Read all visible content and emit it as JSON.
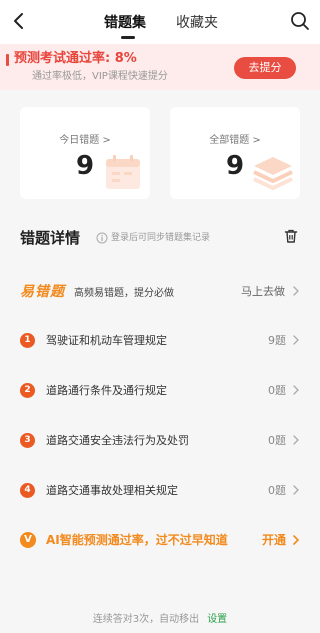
{
  "nav": {
    "tabs": [
      {
        "label": "错题集",
        "active": true
      },
      {
        "label": "收藏夹",
        "active": false
      }
    ]
  },
  "promo": {
    "title": "预测考试通过率: 8%",
    "subtitle": "通过率极低，VIP课程快速提分",
    "button": "去提分",
    "accent": "#e94c40",
    "background": "#fdeceb"
  },
  "stats": {
    "today": {
      "label": "今日错题 >",
      "value": "9"
    },
    "all": {
      "label": "全部错题 >",
      "value": "9"
    }
  },
  "detail": {
    "title": "错题详情",
    "hint": "登录后可同步错题集记录",
    "easy": {
      "logo": "易错题",
      "description": "高频易错题，提分必做",
      "action": "马上去做"
    },
    "items": [
      {
        "num": "1",
        "title": "驾驶证和机动车管理规定",
        "count": "9题"
      },
      {
        "num": "2",
        "title": "道路通行条件及通行规定",
        "count": "0题"
      },
      {
        "num": "3",
        "title": "道路交通安全违法行为及处罚",
        "count": "0题"
      },
      {
        "num": "4",
        "title": "道路交通事故处理相关规定",
        "count": "0题"
      }
    ],
    "ai": {
      "badge": "V",
      "text": "AI智能预测通过率，过不过早知道",
      "action": "开通"
    }
  },
  "footer": {
    "text": "连续答对3次，自动移出",
    "link": "设置"
  },
  "colors": {
    "orange": "#f28a1e",
    "red": "#e94c40",
    "number_badge": "#ea5a22",
    "link_green": "#2aa24a"
  },
  "icons": [
    "back-arrow-icon",
    "search-icon",
    "info-icon",
    "trash-icon",
    "chevron-right-icon"
  ]
}
